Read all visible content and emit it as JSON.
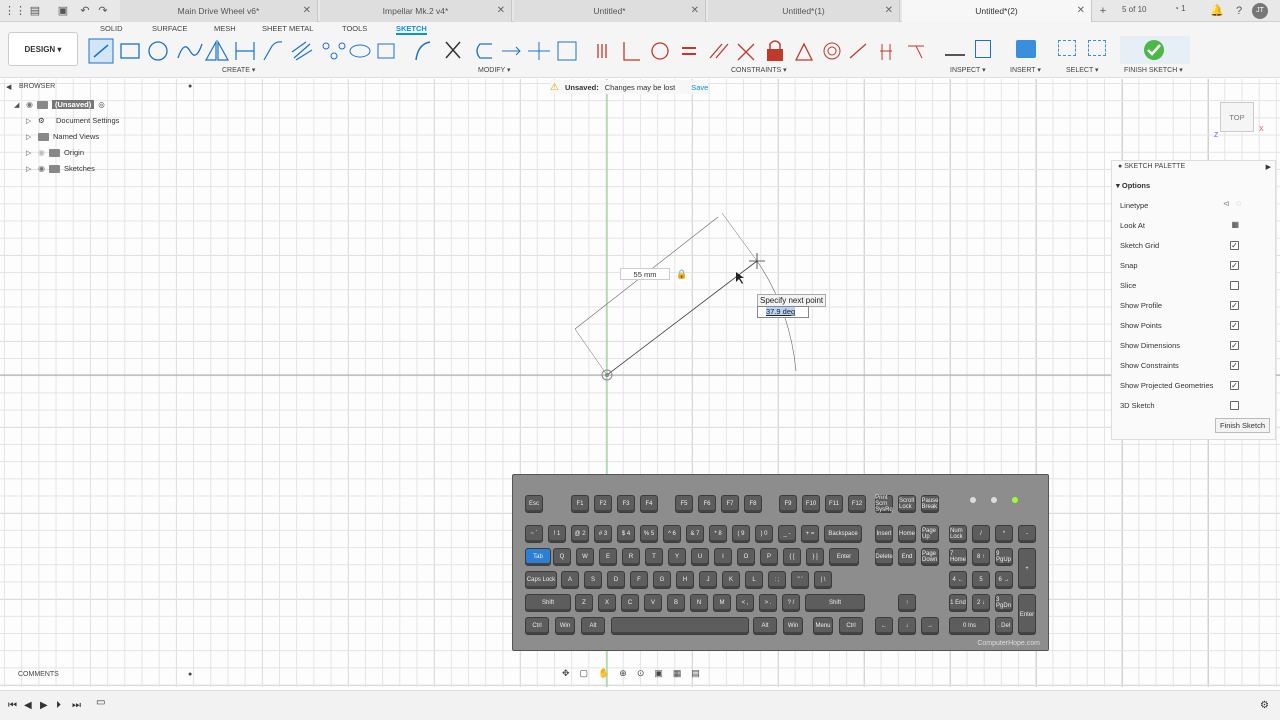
{
  "tabs": [
    {
      "label": "Main Drive Wheel v6*"
    },
    {
      "label": "Impellar Mk.2 v4*"
    },
    {
      "label": "Untitled*"
    },
    {
      "label": "Untitled*(1)"
    },
    {
      "label": "Untitled*(2)"
    }
  ],
  "tabbar_right": {
    "page_count": "5 of 10",
    "notif_count": "1",
    "user": "JT"
  },
  "ribbon": {
    "tabs": [
      "SOLID",
      "SURFACE",
      "MESH",
      "SHEET METAL",
      "TOOLS",
      "SKETCH"
    ],
    "design_label": "DESIGN",
    "groups": [
      "CREATE",
      "MODIFY",
      "CONSTRAINTS",
      "INSPECT",
      "INSERT",
      "SELECT",
      "FINISH SKETCH"
    ]
  },
  "browser": {
    "title": "BROWSER",
    "root": "(Unsaved)",
    "items": [
      "Document Settings",
      "Named Views",
      "Origin",
      "Sketches"
    ]
  },
  "unsaved": {
    "label": "Unsaved:",
    "message": "Changes may be lost",
    "save": "Save"
  },
  "sketch": {
    "dimension": "55 mm",
    "prompt": "Specify next point",
    "angle": "37.9 deg"
  },
  "viewcube": "TOP",
  "palette": {
    "title": "SKETCH PALETTE",
    "section": "Options",
    "rows": [
      {
        "label": "Linetype"
      },
      {
        "label": "Look At"
      },
      {
        "label": "Sketch Grid",
        "checked": true
      },
      {
        "label": "Snap",
        "checked": true
      },
      {
        "label": "Slice",
        "checked": false
      },
      {
        "label": "Show Profile",
        "checked": true
      },
      {
        "label": "Show Points",
        "checked": true
      },
      {
        "label": "Show Dimensions",
        "checked": true
      },
      {
        "label": "Show Constraints",
        "checked": true
      },
      {
        "label": "Show Projected Geometries",
        "checked": true
      },
      {
        "label": "3D Sketch",
        "checked": false
      }
    ],
    "finish": "Finish Sketch"
  },
  "keyboard": {
    "credit": "ComputerHope.com",
    "row_fn": [
      "Esc",
      "F1",
      "F2",
      "F3",
      "F4",
      "F5",
      "F6",
      "F7",
      "F8",
      "F9",
      "F10",
      "F11",
      "F12"
    ],
    "row_num": [
      "~ `",
      "! 1",
      "@ 2",
      "# 3",
      "$ 4",
      "% 5",
      "^ 6",
      "& 7",
      "* 8",
      "( 9",
      ") 0",
      "_ -",
      "+ =",
      "Backspace"
    ],
    "row_q": [
      "Tab",
      "Q",
      "W",
      "E",
      "R",
      "T",
      "Y",
      "U",
      "I",
      "O",
      "P",
      "{ [",
      "} ]",
      "Enter"
    ],
    "row_a": [
      "Caps Lock",
      "A",
      "S",
      "D",
      "F",
      "G",
      "H",
      "J",
      "K",
      "L",
      ": ;",
      "\" '",
      "| \\"
    ],
    "row_z": [
      "Shift",
      "Z",
      "X",
      "C",
      "V",
      "B",
      "N",
      "M",
      "< ,",
      "> .",
      "? /",
      "Shift"
    ],
    "row_bottom": [
      "Ctrl",
      "Win",
      "Alt",
      "",
      "Alt",
      "Win",
      "Menu",
      "Ctrl"
    ],
    "nav": [
      "Print Scrn SysRq",
      "Scroll Lock",
      "Pause Break",
      "Insert",
      "Home",
      "Page Up",
      "Delete",
      "End",
      "Page Down"
    ],
    "arrows": [
      "↑",
      "←",
      "↓",
      "→"
    ],
    "numpad": [
      "Num Lock",
      "/",
      "*",
      "-",
      "7 Home",
      "8 ↑",
      "9 PgUp",
      "+",
      "4 ←",
      "5",
      "6 →",
      "1 End",
      "2 ↓",
      "3 PgDn",
      "Enter",
      "0 Ins",
      ". Del"
    ]
  },
  "comments": {
    "title": "COMMENTS"
  }
}
